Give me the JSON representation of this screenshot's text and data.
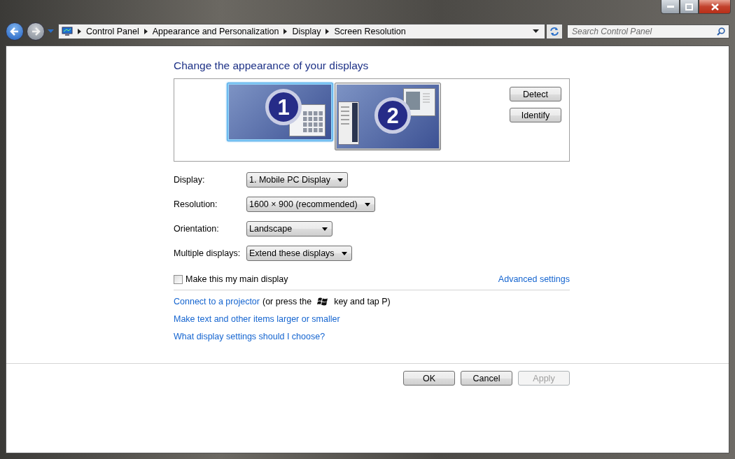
{
  "window": {
    "controls": [
      {
        "kind": "minimize"
      },
      {
        "kind": "maximize"
      },
      {
        "kind": "close"
      }
    ]
  },
  "address_bar": {
    "breadcrumbs": [
      "Control Panel",
      "Appearance and Personalization",
      "Display",
      "Screen Resolution"
    ]
  },
  "search": {
    "placeholder": "Search Control Panel"
  },
  "heading": "Change the appearance of your displays",
  "monitors": [
    {
      "label": "1",
      "selected": true
    },
    {
      "label": "2",
      "selected": false
    }
  ],
  "preview_buttons": [
    "Detect",
    "Identify"
  ],
  "settings": [
    {
      "label": "Display:",
      "value": "1. Mobile PC Display"
    },
    {
      "label": "Resolution:",
      "value": "1600 × 900 (recommended)"
    },
    {
      "label": "Orientation:",
      "value": "Landscape"
    },
    {
      "label": "Multiple displays:",
      "value": "Extend these displays"
    }
  ],
  "main_display_checkbox": {
    "label": "Make this my main display",
    "checked": false
  },
  "advanced_link": "Advanced settings",
  "projector": {
    "link": "Connect to a projector",
    "before_key": "(or press the",
    "after_key": "key and tap P)"
  },
  "links": [
    "Make text and other items larger or smaller",
    "What display settings should I choose?"
  ],
  "buttons": [
    {
      "label": "OK",
      "disabled": false
    },
    {
      "label": "Cancel",
      "disabled": false
    },
    {
      "label": "Apply",
      "disabled": true
    }
  ]
}
